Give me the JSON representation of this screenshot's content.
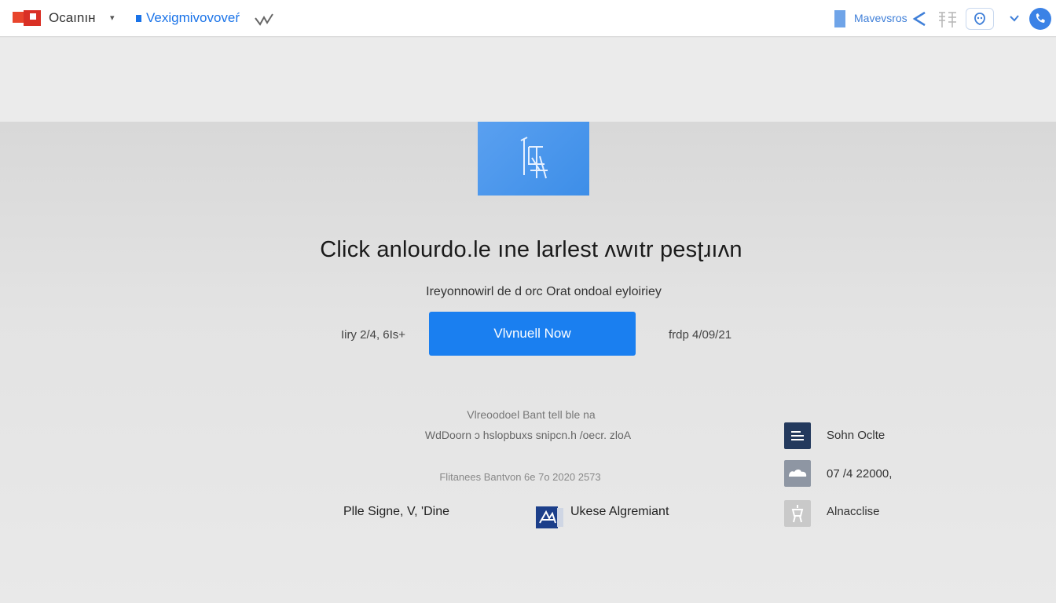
{
  "header": {
    "brand": "Ocaınıн",
    "brand_caret": "▾",
    "app_title": "Vexigmivovoveŕ",
    "right_link": "Mavevsros"
  },
  "hero": {
    "headline": "Click anlourdo.le ıne larlest ʌwıtr pesʈɹıʌn",
    "subline": "Ireyonnowirl de d orc Orat ondoal eyloiriey",
    "side_left": "Iiry 2/4, 6Is+",
    "cta_label": "Vlvnuell Now",
    "side_right": "frdp 4/09/21"
  },
  "meta": {
    "line1": "Vlreoodoel Bant tell ble na",
    "line2": "WdDoorn ɔ hslopbuxs snipcn.h /oecr. zloA",
    "line3": "Flitanees Bantvon 6e 7o 2020 2573"
  },
  "footer": {
    "left": "Plle Signe, V, 'Dine",
    "middle": "Ukese Algremiant"
  },
  "right_list": [
    {
      "label": "Sohn Oclte",
      "icon": "menu-lines-icon"
    },
    {
      "label": "07 /4 22000,",
      "icon": "cloud-icon"
    },
    {
      "label": "Alnacclise",
      "icon": "person-icon"
    }
  ],
  "colors": {
    "accent": "#1a7ff0",
    "link": "#1a73e8",
    "brand_red": "#d93025"
  }
}
